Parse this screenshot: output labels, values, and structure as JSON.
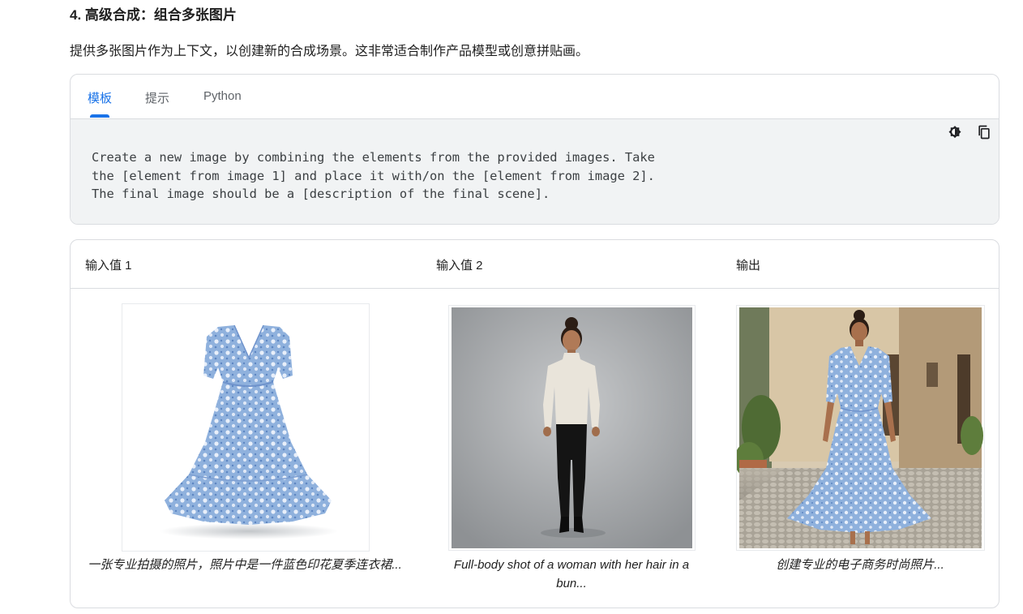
{
  "section": {
    "title": "4. 高级合成：组合多张图片",
    "intro": "提供多张图片作为上下文，以创建新的合成场景。这非常适合制作产品模型或创意拼贴画。"
  },
  "code_card": {
    "tabs": [
      {
        "label": "模板",
        "active": true
      },
      {
        "label": "提示",
        "active": false
      },
      {
        "label": "Python",
        "active": false
      }
    ],
    "code_lines": [
      "Create a new image by combining the elements from the provided images. Take",
      "the [element from image 1] and place it with/on the [element from image 2].",
      "The final image should be a [description of the final scene]."
    ],
    "icons": [
      "theme-toggle-icon",
      "copy-icon"
    ]
  },
  "example": {
    "headers": [
      "输入值 1",
      "输入值 2",
      "输出"
    ],
    "items": [
      {
        "caption": "一张专业拍摄的照片，照片中是一件蓝色印花夏季连衣裙..."
      },
      {
        "caption": "Full-body shot of a woman with her hair in a bun..."
      },
      {
        "caption": "创建专业的电子商务时尚照片..."
      }
    ]
  },
  "colors": {
    "accent": "#1a73e8",
    "code_bg": "#f1f3f4",
    "border": "#dadce0",
    "dress_blue": "#8fb1dd"
  }
}
